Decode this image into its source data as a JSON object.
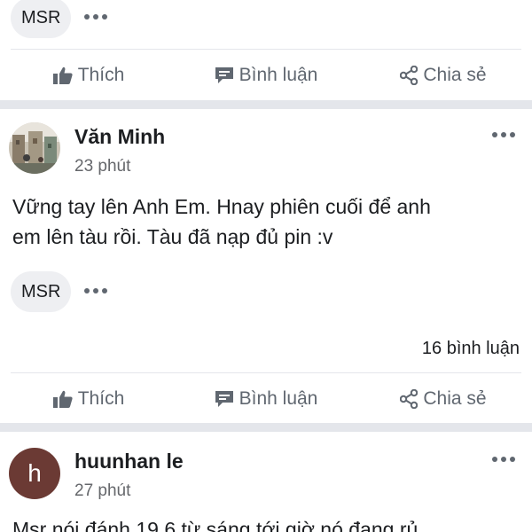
{
  "post_prev": {
    "tag": "MSR",
    "actions": {
      "like": "Thích",
      "comment": "Bình luận",
      "share": "Chia sẻ"
    }
  },
  "post_1": {
    "author": "Văn Minh",
    "time": "23 phút",
    "text_line1": "Vững tay lên Anh Em. Hnay phiên cuối để anh",
    "text_line2": "em lên tàu rồi. Tàu đã nạp đủ pin :v",
    "tag": "MSR",
    "comment_count": "16 bình luận",
    "actions": {
      "like": "Thích",
      "comment": "Bình luận",
      "share": "Chia sẻ"
    }
  },
  "post_2": {
    "author": "huunhan le",
    "avatar_letter": "h",
    "avatar_color": "#6b3a34",
    "time": "27 phút",
    "text_line1": "Msr nói đánh 19.6 từ sáng tới giờ nó đang rủ"
  },
  "colors": {
    "separator": "#e4e6eb",
    "secondary_text": "#65676b",
    "icon": "#606770"
  }
}
